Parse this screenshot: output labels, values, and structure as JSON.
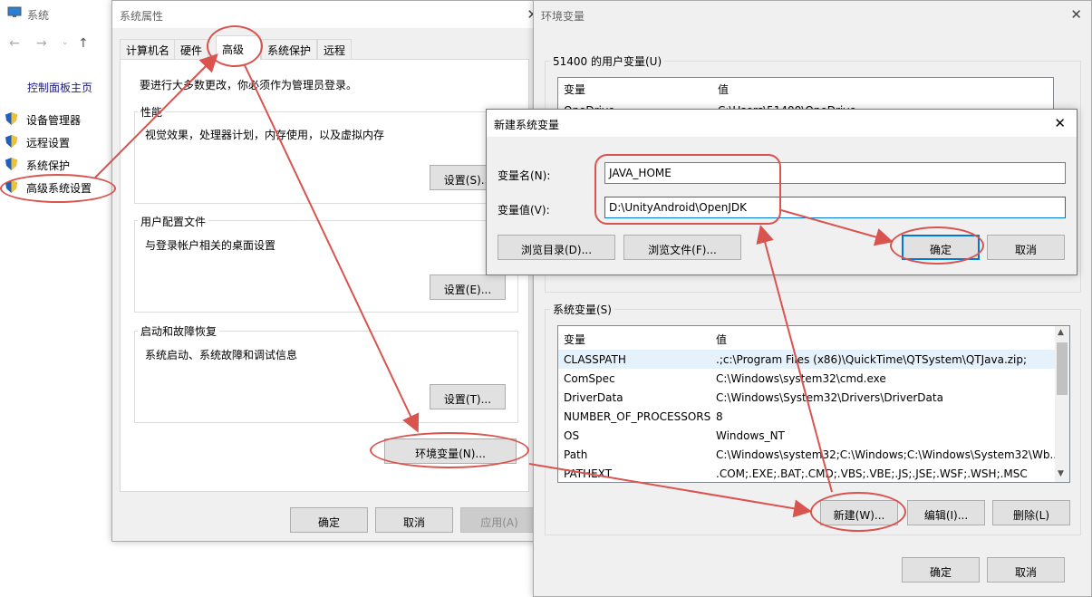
{
  "system_window": {
    "title": "系统",
    "control_panel_home": "控制面板主页",
    "links": [
      "设备管理器",
      "远程设置",
      "系统保护",
      "高级系统设置"
    ]
  },
  "props_window": {
    "title": "系统属性",
    "tabs": [
      "计算机名",
      "硬件",
      "高级",
      "系统保护",
      "远程"
    ],
    "admin_note": "要进行大多数更改，你必须作为管理员登录。",
    "perf": {
      "label": "性能",
      "desc": "视觉效果，处理器计划，内存使用，以及虚拟内存",
      "button": "设置(S)..."
    },
    "profile": {
      "label": "用户配置文件",
      "desc": "与登录帐户相关的桌面设置",
      "button": "设置(E)..."
    },
    "startup": {
      "label": "启动和故障恢复",
      "desc": "系统启动、系统故障和调试信息",
      "button": "设置(T)..."
    },
    "env_button": "环境变量(N)...",
    "ok": "确定",
    "cancel": "取消",
    "apply": "应用(A)"
  },
  "env_window": {
    "title": "环境变量",
    "user_group": "51400 的用户变量(U)",
    "col_var": "变量",
    "col_val": "值",
    "user_vars": [
      {
        "name": "OneDrive",
        "value": "C:\\Users\\51400\\OneDrive"
      }
    ],
    "sys_group": "系统变量(S)",
    "sys_vars": [
      {
        "name": "CLASSPATH",
        "value": ".;c:\\Program Files (x86)\\QuickTime\\QTSystem\\QTJava.zip;"
      },
      {
        "name": "ComSpec",
        "value": "C:\\Windows\\system32\\cmd.exe"
      },
      {
        "name": "DriverData",
        "value": "C:\\Windows\\System32\\Drivers\\DriverData"
      },
      {
        "name": "NUMBER_OF_PROCESSORS",
        "value": "8"
      },
      {
        "name": "OS",
        "value": "Windows_NT"
      },
      {
        "name": "Path",
        "value": "C:\\Windows\\system32;C:\\Windows;C:\\Windows\\System32\\Wb..."
      },
      {
        "name": "PATHEXT",
        "value": ".COM;.EXE;.BAT;.CMD;.VBS;.VBE;.JS;.JSE;.WSF;.WSH;.MSC"
      }
    ],
    "new_btn": "新建(W)...",
    "edit_btn": "编辑(I)...",
    "delete_btn": "删除(L)",
    "ok": "确定",
    "cancel": "取消"
  },
  "new_var_dialog": {
    "title": "新建系统变量",
    "name_label": "变量名(N):",
    "name_value": "JAVA_HOME",
    "value_label": "变量值(V):",
    "value_value": "D:\\UnityAndroid\\OpenJDK",
    "browse_dir": "浏览目录(D)...",
    "browse_file": "浏览文件(F)...",
    "ok": "确定",
    "cancel": "取消"
  },
  "colors": {
    "accent": "#0078d7",
    "callout": "#d9534f",
    "shield_blue": "#1f5fbf",
    "shield_yellow": "#f2c12e"
  }
}
